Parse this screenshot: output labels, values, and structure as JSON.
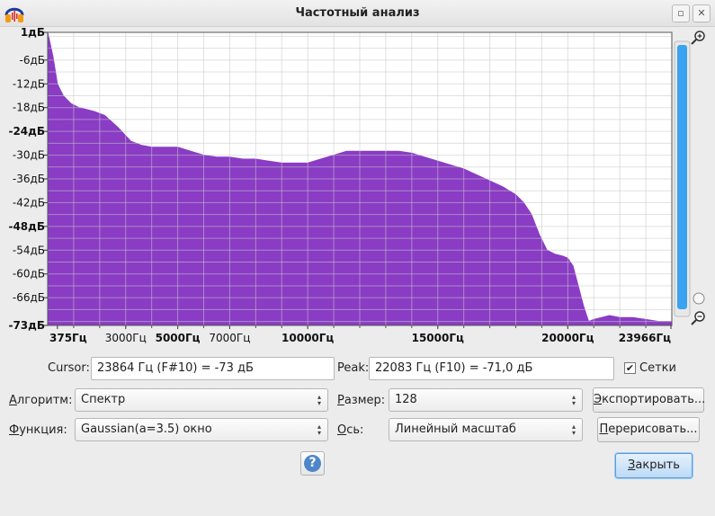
{
  "window": {
    "title": "Частотный анализ",
    "minimize_glyph": "▫",
    "close_glyph": "✕"
  },
  "chart_data": {
    "type": "area",
    "title": "",
    "xlabel": "",
    "ylabel": "",
    "x_unit": "Гц",
    "y_unit": "дБ",
    "xlim": [
      0,
      24000
    ],
    "ylim": [
      -73,
      1
    ],
    "grid": true,
    "fill_color": "#8a3cc4",
    "y_ticks": [
      {
        "value": 1,
        "label": "1дБ",
        "bold": true
      },
      {
        "value": -6,
        "label": "-6дБ",
        "bold": false
      },
      {
        "value": -12,
        "label": "-12дБ",
        "bold": false
      },
      {
        "value": -18,
        "label": "-18дБ",
        "bold": false
      },
      {
        "value": -24,
        "label": "-24дБ",
        "bold": true
      },
      {
        "value": -30,
        "label": "-30дБ",
        "bold": false
      },
      {
        "value": -36,
        "label": "-36дБ",
        "bold": false
      },
      {
        "value": -42,
        "label": "-42дБ",
        "bold": false
      },
      {
        "value": -48,
        "label": "-48дБ",
        "bold": true
      },
      {
        "value": -54,
        "label": "-54дБ",
        "bold": false
      },
      {
        "value": -60,
        "label": "-60дБ",
        "bold": false
      },
      {
        "value": -66,
        "label": "-66дБ",
        "bold": false
      },
      {
        "value": -73,
        "label": "-73дБ",
        "bold": true
      }
    ],
    "x_ticks": [
      {
        "value": 375,
        "label": "375Гц",
        "bold": true
      },
      {
        "value": 3000,
        "label": "3000Гц",
        "bold": false
      },
      {
        "value": 5000,
        "label": "5000Гц",
        "bold": true
      },
      {
        "value": 7000,
        "label": "7000Гц",
        "bold": false
      },
      {
        "value": 10000,
        "label": "10000Гц",
        "bold": true
      },
      {
        "value": 15000,
        "label": "15000Гц",
        "bold": true
      },
      {
        "value": 20000,
        "label": "20000Гц",
        "bold": true
      },
      {
        "value": 23966,
        "label": "23966Гц",
        "bold": true
      }
    ],
    "x": [
      0,
      200,
      375,
      600,
      900,
      1200,
      1500,
      1800,
      2200,
      2700,
      3200,
      3600,
      4000,
      4500,
      5000,
      5500,
      6000,
      6500,
      7000,
      7500,
      8000,
      8500,
      9000,
      9500,
      10000,
      10500,
      11000,
      11500,
      12000,
      12500,
      13000,
      13500,
      14000,
      14500,
      15000,
      15500,
      16000,
      16500,
      17000,
      17500,
      18000,
      18300,
      18600,
      18900,
      19200,
      19500,
      19800,
      20000,
      20200,
      20400,
      20600,
      20800,
      21000,
      21300,
      21600,
      22000,
      22500,
      23000,
      23500,
      23966
    ],
    "y": [
      1,
      -5,
      -12,
      -15,
      -17,
      -18,
      -18.5,
      -19,
      -20,
      -23,
      -26.5,
      -27.5,
      -28,
      -28,
      -28,
      -29,
      -30,
      -30.5,
      -30.5,
      -31,
      -31,
      -31.5,
      -32,
      -32,
      -32,
      -31,
      -30,
      -29,
      -29,
      -29,
      -29,
      -29,
      -29.5,
      -30.5,
      -31.5,
      -32.5,
      -33.5,
      -35,
      -36.5,
      -38,
      -40,
      -42,
      -45,
      -50,
      -54,
      -55,
      -55.5,
      -56,
      -58,
      -63,
      -68,
      -72,
      -71.5,
      -71,
      -70.5,
      -71,
      -71,
      -71.5,
      -72,
      -72
    ]
  },
  "zoom": {
    "zoom_in_icon": "zoom-in-icon",
    "zoom_out_icon": "zoom-out-icon",
    "slider_level": 0.0
  },
  "info": {
    "cursor_label": "Cursor:",
    "cursor_value": "23864 Гц (F#10) = -73 дБ",
    "peak_label": "Peak:",
    "peak_value": "22083 Гц (F10) = -71,0 дБ",
    "grids_checked": true,
    "grids_label": "Сетки"
  },
  "controls": {
    "algorithm_label_u": "А",
    "algorithm_label_rest": "лгоритм:",
    "algorithm_value": "Спектр",
    "size_label_u": "Р",
    "size_label_rest": "азмер:",
    "size_value": "128",
    "function_label_u": "Ф",
    "function_label_rest": "ункция:",
    "function_value": "Gaussian(a=3.5) окно",
    "axis_label_u": "О",
    "axis_label_rest": "сь:",
    "axis_value": "Линейный масштаб",
    "export_u": "Э",
    "export_rest": "кспортировать...",
    "replot_u": "П",
    "replot_rest": "ерерисовать...",
    "close_u": "З",
    "close_rest": "акрыть",
    "help_glyph": "?"
  }
}
